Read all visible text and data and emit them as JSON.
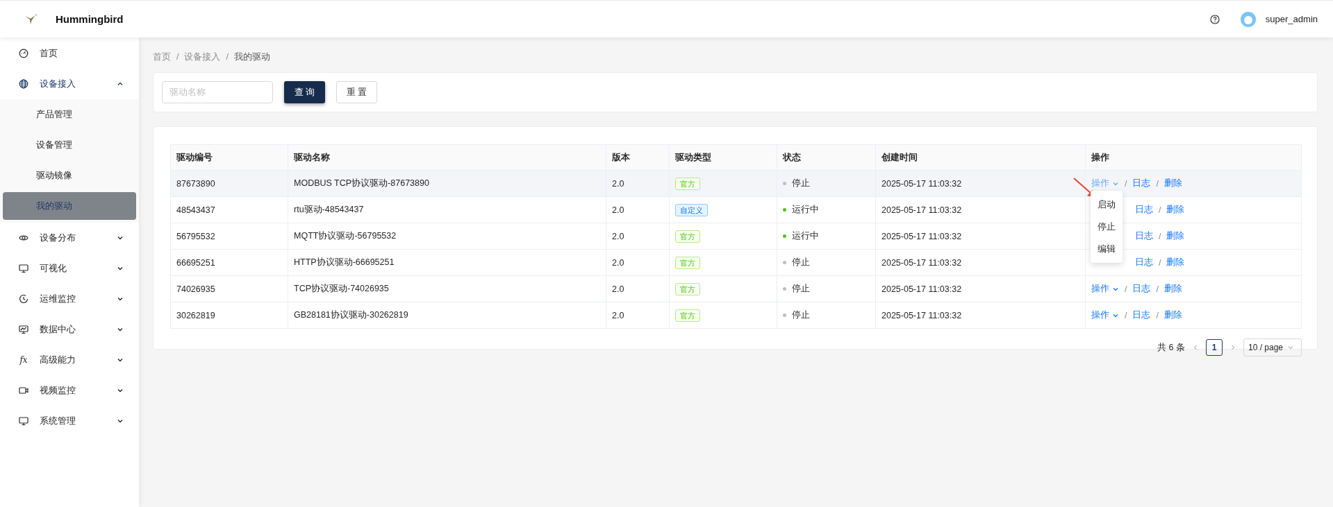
{
  "header": {
    "title": "Hummingbird",
    "user": "super_admin"
  },
  "sidebar": {
    "items": [
      {
        "label": "首页",
        "kind": "gauge"
      },
      {
        "label": "设备接入",
        "kind": "globe",
        "expanded": true,
        "selected": true,
        "children": [
          {
            "label": "产品管理",
            "selected": false
          },
          {
            "label": "设备管理",
            "selected": false
          },
          {
            "label": "驱动镜像",
            "selected": false
          },
          {
            "label": "我的驱动",
            "selected": true
          }
        ]
      },
      {
        "label": "设备分布",
        "kind": "eye",
        "expanded": false,
        "selected": false
      },
      {
        "label": "可视化",
        "kind": "monitor",
        "expanded": false,
        "selected": false
      },
      {
        "label": "运维监控",
        "kind": "clock",
        "expanded": false,
        "selected": false
      },
      {
        "label": "数据中心",
        "kind": "chart",
        "expanded": false,
        "selected": false
      },
      {
        "label": "高级能力",
        "kind": "fx",
        "expanded": false,
        "selected": false
      },
      {
        "label": "视频监控",
        "kind": "video",
        "expanded": false,
        "selected": false
      },
      {
        "label": "系统管理",
        "kind": "monitor",
        "expanded": false,
        "selected": false
      }
    ]
  },
  "breadcrumb": [
    {
      "label": "首页",
      "kind": "item"
    },
    {
      "label": "/",
      "kind": "separator"
    },
    {
      "label": "设备接入",
      "kind": "item"
    },
    {
      "label": "/",
      "kind": "separator"
    },
    {
      "label": "我的驱动",
      "kind": "current"
    }
  ],
  "search": {
    "placeholder": "驱动名称",
    "buttons": [
      {
        "label": "查 询",
        "kind": "primary"
      },
      {
        "label": "重 置",
        "kind": "default"
      }
    ]
  },
  "table": {
    "columns": [
      "驱动编号",
      "驱动名称",
      "版本",
      "驱动类型",
      "状态",
      "创建时间",
      "操作"
    ],
    "rows": [
      {
        "id": "87673890",
        "name": "MODBUS TCP协议驱动-87673890",
        "version": "2.0",
        "type": {
          "label": "官方",
          "kind": "official"
        },
        "status": {
          "label": "停止",
          "color": "#bfbfbf"
        },
        "created": "2025-05-17 11:03:32",
        "highlighted": true,
        "actions": [
          {
            "kind": "dropdown",
            "label": "操作",
            "active": true
          },
          {
            "kind": "separator",
            "label": "/"
          },
          {
            "kind": "log",
            "label": "日志"
          },
          {
            "kind": "separator",
            "label": "/"
          },
          {
            "kind": "delete",
            "label": "删除"
          }
        ]
      },
      {
        "id": "48543437",
        "name": "rtu驱动-48543437",
        "version": "2.0",
        "type": {
          "label": "自定义",
          "kind": "custom"
        },
        "status": {
          "label": "运行中",
          "color": "#52c41a"
        },
        "created": "2025-05-17 11:03:32",
        "highlighted": false,
        "actions": [
          {
            "kind": "log",
            "label": "日志"
          },
          {
            "kind": "separator",
            "label": "/"
          },
          {
            "kind": "delete",
            "label": "删除"
          }
        ]
      },
      {
        "id": "56795532",
        "name": "MQTT协议驱动-56795532",
        "version": "2.0",
        "type": {
          "label": "官方",
          "kind": "official"
        },
        "status": {
          "label": "运行中",
          "color": "#52c41a"
        },
        "created": "2025-05-17 11:03:32",
        "highlighted": false,
        "actions": [
          {
            "kind": "log",
            "label": "日志"
          },
          {
            "kind": "separator",
            "label": "/"
          },
          {
            "kind": "delete",
            "label": "删除"
          }
        ]
      },
      {
        "id": "66695251",
        "name": "HTTP协议驱动-66695251",
        "version": "2.0",
        "type": {
          "label": "官方",
          "kind": "official"
        },
        "status": {
          "label": "停止",
          "color": "#bfbfbf"
        },
        "created": "2025-05-17 11:03:32",
        "highlighted": false,
        "actions": [
          {
            "kind": "log",
            "label": "日志"
          },
          {
            "kind": "separator",
            "label": "/"
          },
          {
            "kind": "delete",
            "label": "删除"
          }
        ]
      },
      {
        "id": "74026935",
        "name": "TCP协议驱动-74026935",
        "version": "2.0",
        "type": {
          "label": "官方",
          "kind": "official"
        },
        "status": {
          "label": "停止",
          "color": "#bfbfbf"
        },
        "created": "2025-05-17 11:03:32",
        "highlighted": false,
        "actions": [
          {
            "kind": "dropdown",
            "label": "操作",
            "active": false
          },
          {
            "kind": "separator",
            "label": "/"
          },
          {
            "kind": "log",
            "label": "日志"
          },
          {
            "kind": "separator",
            "label": "/"
          },
          {
            "kind": "delete",
            "label": "删除"
          }
        ]
      },
      {
        "id": "30262819",
        "name": "GB28181协议驱动-30262819",
        "version": "2.0",
        "type": {
          "label": "官方",
          "kind": "official"
        },
        "status": {
          "label": "停止",
          "color": "#bfbfbf"
        },
        "created": "2025-05-17 11:03:32",
        "highlighted": false,
        "actions": [
          {
            "kind": "dropdown",
            "label": "操作",
            "active": false
          },
          {
            "kind": "separator",
            "label": "/"
          },
          {
            "kind": "log",
            "label": "日志"
          },
          {
            "kind": "separator",
            "label": "/"
          },
          {
            "kind": "delete",
            "label": "删除"
          }
        ]
      }
    ]
  },
  "dropdown": {
    "items": [
      "启动",
      "停止",
      "编辑"
    ]
  },
  "pagination": {
    "total": "共 6 条",
    "pages": [
      {
        "label": "1",
        "selected": true
      }
    ],
    "page_size": "10 / page"
  }
}
